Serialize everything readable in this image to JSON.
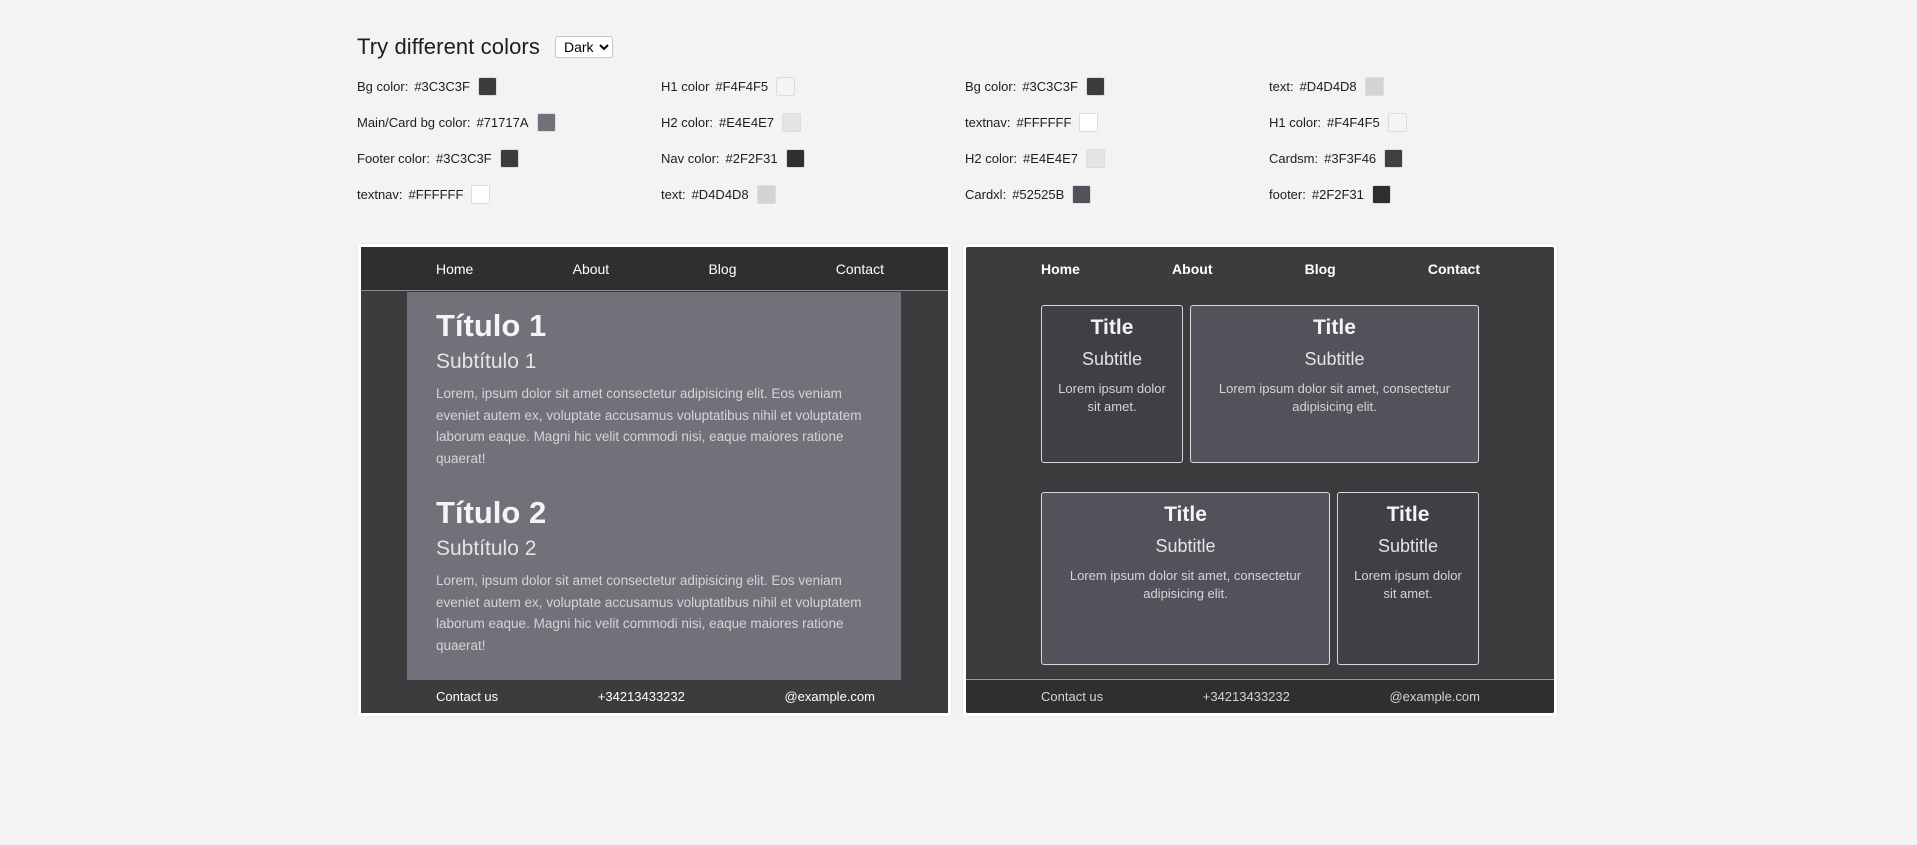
{
  "header": {
    "title": "Try different colors",
    "theme_selected": "Dark"
  },
  "palette": [
    [
      {
        "label": "Bg color:",
        "hex": "#3C3C3F"
      },
      {
        "label": "Main/Card bg color:",
        "hex": "#71717A"
      },
      {
        "label": "Footer color:",
        "hex": "#3C3C3F"
      },
      {
        "label": "textnav:",
        "hex": "#FFFFFF"
      }
    ],
    [
      {
        "label": "H1 color",
        "hex": "#F4F4F5"
      },
      {
        "label": "H2 color:",
        "hex": "#E4E4E7"
      },
      {
        "label": "Nav color:",
        "hex": "#2F2F31"
      },
      {
        "label": "text:",
        "hex": "#D4D4D8"
      }
    ],
    [
      {
        "label": "Bg color:",
        "hex": "#3C3C3F"
      },
      {
        "label": "textnav:",
        "hex": "#FFFFFF"
      },
      {
        "label": "H2 color:",
        "hex": "#E4E4E7"
      },
      {
        "label": "Cardxl:",
        "hex": "#52525B"
      }
    ],
    [
      {
        "label": "text:",
        "hex": "#D4D4D8"
      },
      {
        "label": "H1 color:",
        "hex": "#F4F4F5"
      },
      {
        "label": "Cardsm:",
        "hex": "#3F3F46"
      },
      {
        "label": "footer:",
        "hex": "#2F2F31"
      }
    ]
  ],
  "nav": {
    "home": "Home",
    "about": "About",
    "blog": "Blog",
    "contact": "Contact"
  },
  "left_preview": {
    "sections": [
      {
        "title": "Título 1",
        "subtitle": "Subtítulo 1",
        "text": "Lorem, ipsum dolor sit amet consectetur adipisicing elit. Eos veniam eveniet autem ex, voluptate accusamus voluptatibus nihil et voluptatem laborum eaque. Magni hic velit commodi nisi, eaque maiores ratione quaerat!"
      },
      {
        "title": "Título 2",
        "subtitle": "Subtítulo 2",
        "text": "Lorem, ipsum dolor sit amet consectetur adipisicing elit. Eos veniam eveniet autem ex, voluptate accusamus voluptatibus nihil et voluptatem laborum eaque. Magni hic velit commodi nisi, eaque maiores ratione quaerat!"
      }
    ]
  },
  "right_preview": {
    "cards": [
      {
        "title": "Title",
        "subtitle": "Subtitle",
        "text": "Lorem ipsum dolor sit amet."
      },
      {
        "title": "Title",
        "subtitle": "Subtitle",
        "text": "Lorem ipsum dolor sit amet, consectetur adipisicing elit."
      },
      {
        "title": "Title",
        "subtitle": "Subtitle",
        "text": "Lorem ipsum dolor sit amet, consectetur adipisicing elit."
      },
      {
        "title": "Title",
        "subtitle": "Subtitle",
        "text": "Lorem ipsum dolor sit amet."
      }
    ]
  },
  "footer": {
    "contact": "Contact us",
    "phone": "+34213433232",
    "email": "@example.com"
  }
}
